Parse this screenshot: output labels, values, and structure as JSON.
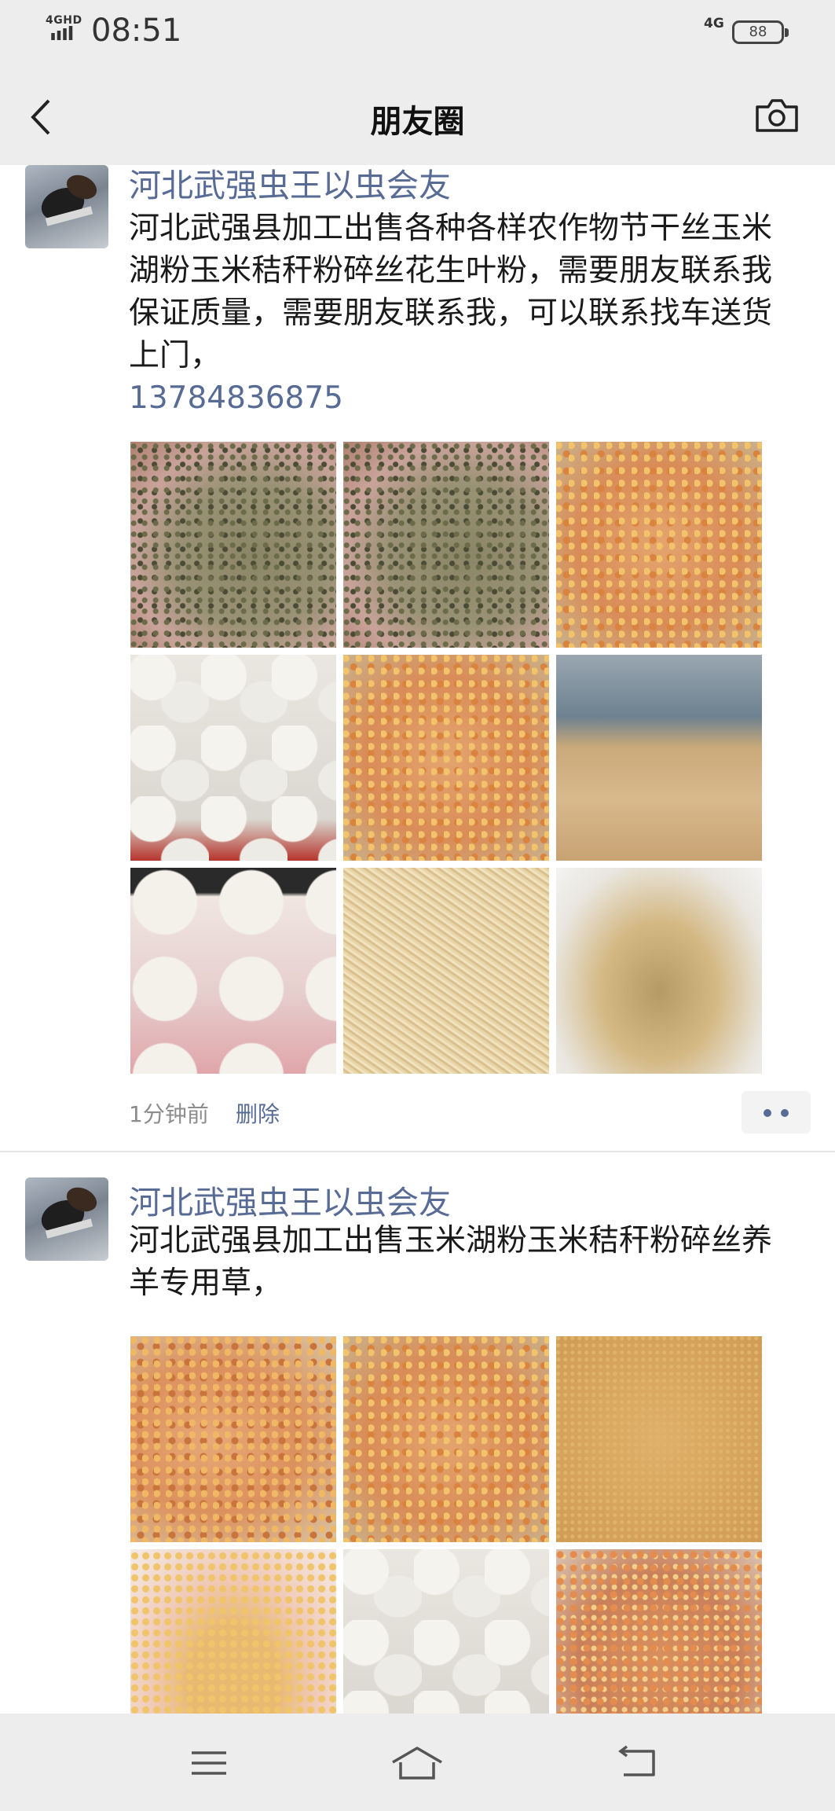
{
  "status_bar": {
    "network_small": "4GHD",
    "time": "08:51",
    "network": "4G",
    "battery": "88"
  },
  "nav": {
    "title": "朋友圈",
    "back_icon": "chevron-left-icon",
    "camera_icon": "camera-icon"
  },
  "posts": [
    {
      "author": "河北武强虫王以虫会友",
      "content": "河北武强县加工出售各种各样农作物节干丝玉米湖粉玉米秸秆粉碎丝花生叶粉，需要朋友联系我保证质量，需要朋友联系我，可以联系找车送货上门，",
      "phone": "13784836875",
      "images": [
        "t-stalk",
        "t-stalk",
        "t-corn",
        "t-bags",
        "t-corn",
        "t-field",
        "t-sacks",
        "t-straw",
        "t-hay"
      ],
      "time": "1分钟前",
      "delete_label": "删除"
    },
    {
      "author": "河北武强虫王以虫会友",
      "content": "河北武强县加工出售玉米湖粉玉米秸秆粉碎丝养羊专用草，",
      "images": [
        "t-cob",
        "t-corn",
        "t-powder",
        "t-hand",
        "t-bags",
        "t-corn2"
      ]
    }
  ],
  "bottom_nav": {
    "menu_icon": "menu-icon",
    "home_icon": "home-icon",
    "back_icon": "return-icon"
  },
  "colors": {
    "link": "#576b95",
    "bar_bg": "#ededed"
  }
}
